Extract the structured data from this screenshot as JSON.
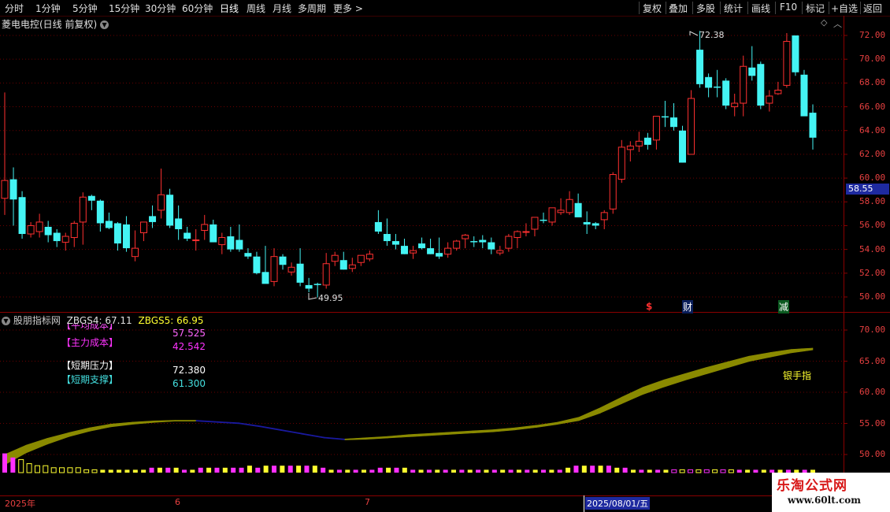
{
  "toolbar": {
    "periods": [
      "分时",
      "1分钟",
      "5分钟",
      "15分钟",
      "30分钟",
      "60分钟",
      "日线",
      "周线",
      "月线",
      "多周期",
      "更多"
    ],
    "right_buttons": [
      "复权",
      "叠加",
      "多股",
      "统计",
      "画线",
      "F10",
      "标记",
      "+自选",
      "返回"
    ]
  },
  "chart_title": "菱电电控(日线 前复权)",
  "price_axis": [
    "72.00",
    "70.00",
    "68.00",
    "66.00",
    "64.00",
    "62.00",
    "60.00",
    "58.00",
    "56.00",
    "54.00",
    "52.00",
    "50.00"
  ],
  "current_price_tag": "58.55",
  "annotations": {
    "high": "72.38",
    "low": "49.95"
  },
  "event_markers": [
    "$",
    "财",
    "减"
  ],
  "indicator": {
    "name": "股朋指标网",
    "zbgs4": "ZBGS4: 67.11",
    "zbgs5": "ZBGS5: 66.95",
    "rows": [
      {
        "label": "【平均成本】",
        "value": "57.525"
      },
      {
        "label": "【主力成本】",
        "value": "42.542"
      },
      {
        "label": "【短期压力】",
        "value": "72.380"
      },
      {
        "label": "【短期支撑】",
        "value": "61.300"
      }
    ],
    "signal_text": "银手指",
    "axis": [
      "70.00",
      "65.00",
      "60.00",
      "55.00",
      "50.00"
    ]
  },
  "date_axis": {
    "labels": [
      "2025年",
      "6",
      "7"
    ],
    "cursor": "2025/08/01/五"
  },
  "watermark": {
    "line1": "乐淘公式网",
    "line2": "www.60lt.com"
  },
  "colors": {
    "up": "#ff3030",
    "down": "#44f4f4",
    "grid": "#6a0000",
    "ribbon": "#8a8a00",
    "ribbon_dark": "#1a1aa0",
    "magenta": "#ff30ff",
    "yellow": "#ffff30"
  },
  "chart_data": [
    {
      "type": "candlestick",
      "title": "菱电电控(日线 前复权)",
      "ylim": [
        49,
        73
      ],
      "candles": [
        {
          "o": 58.3,
          "h": 67.2,
          "l": 56.9,
          "c": 59.8
        },
        {
          "o": 59.9,
          "h": 60.9,
          "l": 56.0,
          "c": 58.2
        },
        {
          "o": 58.4,
          "h": 58.9,
          "l": 54.9,
          "c": 55.3
        },
        {
          "o": 55.3,
          "h": 56.3,
          "l": 55.0,
          "c": 56.0
        },
        {
          "o": 55.5,
          "h": 57.0,
          "l": 55.0,
          "c": 56.3
        },
        {
          "o": 55.9,
          "h": 56.4,
          "l": 54.6,
          "c": 55.2
        },
        {
          "o": 55.4,
          "h": 55.7,
          "l": 54.2,
          "c": 54.7
        },
        {
          "o": 54.6,
          "h": 55.4,
          "l": 53.9,
          "c": 55.1
        },
        {
          "o": 55.0,
          "h": 56.4,
          "l": 54.2,
          "c": 56.2
        },
        {
          "o": 56.3,
          "h": 58.8,
          "l": 54.4,
          "c": 58.4
        },
        {
          "o": 58.5,
          "h": 58.6,
          "l": 57.3,
          "c": 58.1
        },
        {
          "o": 58.1,
          "h": 58.2,
          "l": 55.5,
          "c": 56.2
        },
        {
          "o": 56.4,
          "h": 57.1,
          "l": 55.7,
          "c": 55.8
        },
        {
          "o": 56.2,
          "h": 56.3,
          "l": 53.9,
          "c": 54.5
        },
        {
          "o": 56.1,
          "h": 56.8,
          "l": 53.8,
          "c": 54.1
        },
        {
          "o": 53.4,
          "h": 55.6,
          "l": 53.0,
          "c": 54.1
        },
        {
          "o": 55.4,
          "h": 56.1,
          "l": 54.7,
          "c": 56.3
        },
        {
          "o": 56.8,
          "h": 57.7,
          "l": 55.8,
          "c": 56.3
        },
        {
          "o": 57.3,
          "h": 60.8,
          "l": 56.6,
          "c": 58.6
        },
        {
          "o": 58.6,
          "h": 59.1,
          "l": 55.8,
          "c": 56.0
        },
        {
          "o": 56.6,
          "h": 57.7,
          "l": 54.8,
          "c": 55.7
        },
        {
          "o": 55.4,
          "h": 55.9,
          "l": 54.7,
          "c": 54.9
        },
        {
          "o": 54.8,
          "h": 55.7,
          "l": 53.9,
          "c": 54.8
        },
        {
          "o": 55.6,
          "h": 56.9,
          "l": 54.8,
          "c": 56.1
        },
        {
          "o": 56.1,
          "h": 56.5,
          "l": 54.8,
          "c": 54.6
        },
        {
          "o": 54.4,
          "h": 55.4,
          "l": 53.6,
          "c": 55.0
        },
        {
          "o": 55.1,
          "h": 55.9,
          "l": 53.8,
          "c": 54.0
        },
        {
          "o": 54.8,
          "h": 56.1,
          "l": 53.8,
          "c": 54.0
        },
        {
          "o": 53.7,
          "h": 54.1,
          "l": 53.2,
          "c": 53.4
        },
        {
          "o": 53.4,
          "h": 53.8,
          "l": 51.9,
          "c": 52.0
        },
        {
          "o": 52.1,
          "h": 54.3,
          "l": 51.4,
          "c": 51.1
        },
        {
          "o": 51.3,
          "h": 54.1,
          "l": 50.9,
          "c": 53.4
        },
        {
          "o": 53.4,
          "h": 53.6,
          "l": 52.3,
          "c": 52.7
        },
        {
          "o": 52.1,
          "h": 52.9,
          "l": 51.8,
          "c": 52.5
        },
        {
          "o": 52.8,
          "h": 54.1,
          "l": 50.9,
          "c": 51.2
        },
        {
          "o": 51.0,
          "h": 51.6,
          "l": 50.4,
          "c": 50.7
        },
        {
          "o": 51.1,
          "h": 51.2,
          "l": 49.95,
          "c": 51.0
        },
        {
          "o": 51.0,
          "h": 53.7,
          "l": 50.7,
          "c": 52.8
        },
        {
          "o": 53.0,
          "h": 53.8,
          "l": 52.6,
          "c": 53.5
        },
        {
          "o": 53.1,
          "h": 53.8,
          "l": 52.3,
          "c": 52.3
        },
        {
          "o": 52.4,
          "h": 53.3,
          "l": 52.1,
          "c": 52.7
        },
        {
          "o": 52.9,
          "h": 53.3,
          "l": 52.6,
          "c": 53.5
        },
        {
          "o": 53.2,
          "h": 53.9,
          "l": 53.0,
          "c": 53.6
        },
        {
          "o": 56.3,
          "h": 57.3,
          "l": 55.3,
          "c": 55.5
        },
        {
          "o": 55.3,
          "h": 56.6,
          "l": 54.3,
          "c": 54.7
        },
        {
          "o": 54.7,
          "h": 55.3,
          "l": 54.0,
          "c": 54.4
        },
        {
          "o": 54.3,
          "h": 54.9,
          "l": 53.6,
          "c": 53.6
        },
        {
          "o": 53.7,
          "h": 54.3,
          "l": 53.2,
          "c": 53.9
        },
        {
          "o": 54.5,
          "h": 55.0,
          "l": 54.0,
          "c": 54.1
        },
        {
          "o": 54.1,
          "h": 54.9,
          "l": 53.6,
          "c": 53.6
        },
        {
          "o": 53.7,
          "h": 55.0,
          "l": 53.2,
          "c": 53.4
        },
        {
          "o": 53.6,
          "h": 54.6,
          "l": 53.3,
          "c": 54.1
        },
        {
          "o": 54.1,
          "h": 54.8,
          "l": 53.9,
          "c": 54.7
        },
        {
          "o": 54.9,
          "h": 55.3,
          "l": 54.1,
          "c": 55.2
        },
        {
          "o": 54.7,
          "h": 55.1,
          "l": 54.2,
          "c": 54.6
        },
        {
          "o": 54.8,
          "h": 55.2,
          "l": 54.1,
          "c": 54.6
        },
        {
          "o": 54.6,
          "h": 55.0,
          "l": 53.6,
          "c": 54.0
        },
        {
          "o": 53.7,
          "h": 54.3,
          "l": 53.5,
          "c": 53.9
        },
        {
          "o": 54.1,
          "h": 55.3,
          "l": 53.8,
          "c": 55.1
        },
        {
          "o": 55.0,
          "h": 55.6,
          "l": 54.1,
          "c": 55.5
        },
        {
          "o": 55.5,
          "h": 56.2,
          "l": 55.1,
          "c": 55.5
        },
        {
          "o": 55.7,
          "h": 56.7,
          "l": 55.1,
          "c": 56.7
        },
        {
          "o": 56.5,
          "h": 57.1,
          "l": 56.2,
          "c": 56.4
        },
        {
          "o": 56.3,
          "h": 57.4,
          "l": 56.0,
          "c": 57.5
        },
        {
          "o": 57.1,
          "h": 58.3,
          "l": 56.9,
          "c": 57.3
        },
        {
          "o": 57.1,
          "h": 58.9,
          "l": 56.9,
          "c": 58.2
        },
        {
          "o": 57.9,
          "h": 58.7,
          "l": 56.8,
          "c": 56.7
        },
        {
          "o": 56.3,
          "h": 57.2,
          "l": 55.3,
          "c": 56.1
        },
        {
          "o": 56.2,
          "h": 56.3,
          "l": 55.7,
          "c": 56.0
        },
        {
          "o": 56.5,
          "h": 57.3,
          "l": 55.7,
          "c": 57.1
        },
        {
          "o": 57.4,
          "h": 60.5,
          "l": 57.0,
          "c": 60.3
        },
        {
          "o": 59.9,
          "h": 63.2,
          "l": 59.6,
          "c": 62.6
        },
        {
          "o": 62.4,
          "h": 63.1,
          "l": 61.4,
          "c": 62.7
        },
        {
          "o": 62.7,
          "h": 63.9,
          "l": 62.2,
          "c": 63.1
        },
        {
          "o": 63.4,
          "h": 63.8,
          "l": 62.4,
          "c": 62.8
        },
        {
          "o": 63.2,
          "h": 65.2,
          "l": 62.4,
          "c": 65.2
        },
        {
          "o": 65.2,
          "h": 66.5,
          "l": 64.3,
          "c": 65.1
        },
        {
          "o": 65.1,
          "h": 66.3,
          "l": 64.0,
          "c": 64.3
        },
        {
          "o": 64.0,
          "h": 64.4,
          "l": 61.3,
          "c": 61.3
        },
        {
          "o": 62.0,
          "h": 67.4,
          "l": 62.0,
          "c": 66.7
        },
        {
          "o": 70.8,
          "h": 72.38,
          "l": 67.6,
          "c": 67.9
        },
        {
          "o": 68.5,
          "h": 68.8,
          "l": 66.8,
          "c": 67.6
        },
        {
          "o": 67.7,
          "h": 69.1,
          "l": 66.8,
          "c": 67.6
        },
        {
          "o": 68.2,
          "h": 68.4,
          "l": 65.8,
          "c": 66.1
        },
        {
          "o": 66.0,
          "h": 67.1,
          "l": 65.2,
          "c": 66.3
        },
        {
          "o": 66.3,
          "h": 70.3,
          "l": 65.2,
          "c": 69.4
        },
        {
          "o": 69.3,
          "h": 71.1,
          "l": 68.2,
          "c": 68.6
        },
        {
          "o": 69.6,
          "h": 69.8,
          "l": 65.8,
          "c": 66.1
        },
        {
          "o": 66.3,
          "h": 67.4,
          "l": 65.6,
          "c": 66.9
        },
        {
          "o": 67.1,
          "h": 68.1,
          "l": 67.0,
          "c": 67.4
        },
        {
          "o": 67.8,
          "h": 72.2,
          "l": 67.6,
          "c": 71.5
        },
        {
          "o": 72.0,
          "h": 72.0,
          "l": 68.6,
          "c": 68.9
        },
        {
          "o": 68.7,
          "h": 69.1,
          "l": 65.3,
          "c": 65.2
        },
        {
          "o": 65.5,
          "h": 66.2,
          "l": 62.4,
          "c": 63.4
        }
      ]
    },
    {
      "type": "area",
      "title": "股朋指标网",
      "ylim": [
        47.5,
        72.5
      ],
      "series": [
        {
          "name": "ZBGS4",
          "values": [
            50.0,
            51.5,
            52.6,
            53.5,
            54.3,
            54.9,
            55.2,
            55.4,
            55.5,
            55.5,
            55.3,
            55.1,
            54.6,
            54.0,
            53.4,
            52.8,
            52.5,
            52.7,
            52.9,
            53.2,
            53.4,
            53.6,
            53.8,
            54.0,
            54.3,
            54.7,
            55.2,
            56.0,
            57.5,
            59.2,
            60.8,
            62.0,
            63.0,
            64.0,
            64.9,
            65.8,
            66.4,
            66.9,
            67.1
          ]
        },
        {
          "name": "ZBGS5",
          "values": [
            48.5,
            50.4,
            51.8,
            53.0,
            53.9,
            54.6,
            55.0,
            55.3,
            55.5,
            55.5,
            55.3,
            55.1,
            54.6,
            54.0,
            53.4,
            52.8,
            52.5,
            52.6,
            52.8,
            53.0,
            53.2,
            53.4,
            53.6,
            53.8,
            54.1,
            54.5,
            55.0,
            55.6,
            56.8,
            58.3,
            59.8,
            61.0,
            62.1,
            63.1,
            64.1,
            65.1,
            65.8,
            66.5,
            66.95
          ]
        }
      ],
      "histogram": [
        9,
        7,
        6,
        4,
        3,
        3,
        2,
        2,
        2,
        2,
        1,
        1,
        1,
        1,
        1,
        1,
        1,
        1,
        2,
        2,
        2,
        2,
        1,
        1,
        2,
        2,
        2,
        2,
        2,
        2,
        3,
        2,
        3,
        3,
        3,
        3,
        3,
        3,
        3,
        2,
        1,
        1,
        1,
        1,
        1,
        1,
        2,
        2,
        2,
        2,
        1,
        1,
        1,
        1,
        1,
        1,
        1,
        1,
        1,
        1,
        1,
        1,
        1,
        1,
        1,
        1,
        1,
        1,
        1,
        2,
        3,
        3,
        3,
        3,
        3,
        2,
        2,
        1,
        1,
        1,
        1,
        1,
        1,
        1,
        1,
        1,
        1,
        1,
        1,
        1,
        1,
        1,
        1,
        1,
        1,
        1,
        1,
        1,
        1,
        1
      ]
    }
  ]
}
